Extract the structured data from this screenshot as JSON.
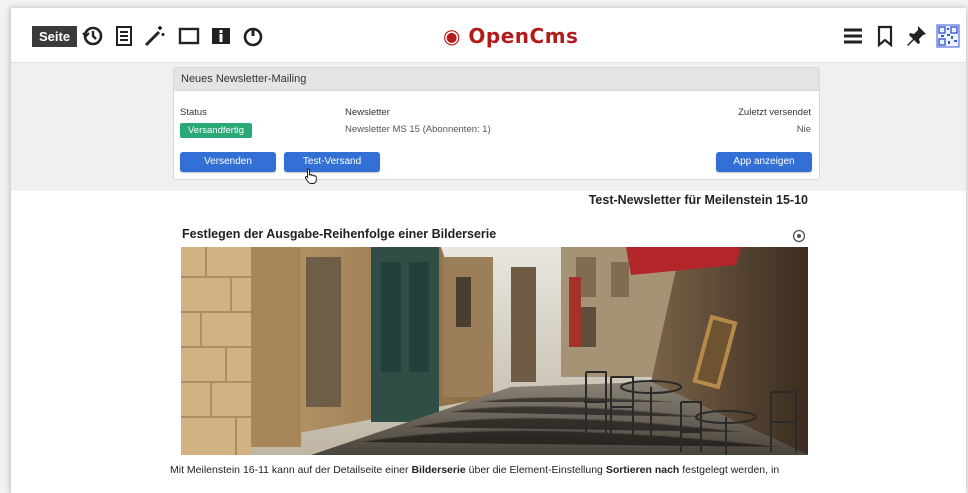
{
  "toolbar": {
    "seite_label": "Seite",
    "icons_left": [
      "history-icon",
      "document-icon",
      "magic-wand-icon",
      "window-icon",
      "info-icon",
      "power-icon"
    ],
    "logo": {
      "open": "◉ OpenCms",
      "cms": ""
    },
    "icons_right": [
      "hamburger-menu-icon",
      "bookmark-icon",
      "pin-icon",
      "qr-code-icon"
    ]
  },
  "newsletter_panel": {
    "title": "Neues Newsletter-Mailing",
    "status_label": "Status",
    "status_value": "Versandfertig",
    "newsletter_label": "Newsletter",
    "newsletter_value": "Newsletter MS 15 (Abonnenten: 1)",
    "last_sent_label": "Zuletzt versendet",
    "last_sent_value": "Nie",
    "btn_send": "Versenden",
    "btn_test": "Test-Versand",
    "btn_app": "App anzeigen"
  },
  "content": {
    "page_heading": "Test-Newsletter für Meilenstein 15-10",
    "article_title": "Festlegen der Ausgabe-Reihenfolge einer Bilderserie",
    "article_text": {
      "p1": "Mit Meilenstein 16-11 kann auf der Detailseite einer ",
      "b1": "Bilderserie",
      "p2": " über die Element-Einstellung ",
      "b2": "Sortieren nach",
      "p3": " festgelegt werden, in"
    }
  },
  "colors": {
    "status_badge": "#2aa878",
    "button_blue": "#3270d6",
    "logo_red": "#b31b1b",
    "logo_blue": "#1a3f8f"
  }
}
